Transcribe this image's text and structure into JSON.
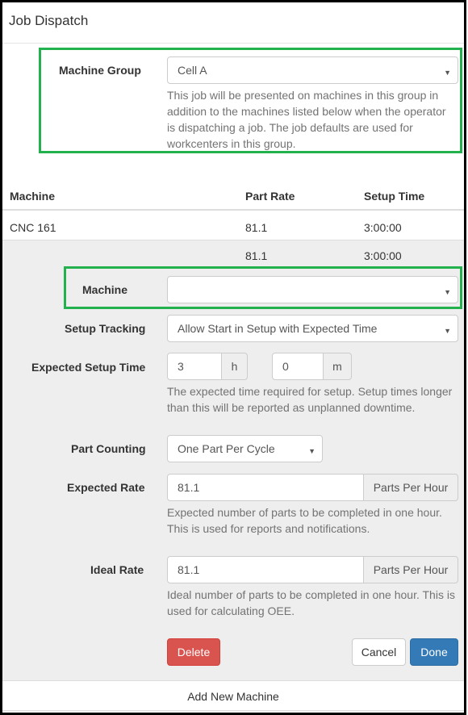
{
  "dialog": {
    "title": "Job Dispatch"
  },
  "machine_group": {
    "label": "Machine Group",
    "value": "Cell A",
    "help": "This job will be presented on machines in this group in addition to the machines listed below when the operator is dispatching a job. The job defaults are used for workcenters in this group."
  },
  "table": {
    "columns": [
      "Machine",
      "Part Rate",
      "Setup Time"
    ],
    "rows": [
      {
        "machine": "CNC 161",
        "part_rate": "81.1",
        "setup_time": "3:00:00"
      },
      {
        "machine": "",
        "part_rate": "81.1",
        "setup_time": "3:00:00"
      }
    ]
  },
  "edit": {
    "machine": {
      "label": "Machine",
      "value": ""
    },
    "setup_tracking": {
      "label": "Setup Tracking",
      "value": "Allow Start in Setup with Expected Time"
    },
    "expected_setup_time": {
      "label": "Expected Setup Time",
      "hours": "3",
      "hours_unit": "h",
      "minutes": "0",
      "minutes_unit": "m",
      "help": "The expected time required for setup. Setup times longer than this will be reported as unplanned downtime."
    },
    "part_counting": {
      "label": "Part Counting",
      "value": "One Part Per Cycle"
    },
    "expected_rate": {
      "label": "Expected Rate",
      "value": "81.1",
      "unit": "Parts Per Hour",
      "help": "Expected number of parts to be completed in one hour. This is used for reports and notifications."
    },
    "ideal_rate": {
      "label": "Ideal Rate",
      "value": "81.1",
      "unit": "Parts Per Hour",
      "help": "Ideal number of parts to be completed in one hour. This is used for calculating OEE."
    },
    "buttons": {
      "delete": "Delete",
      "cancel": "Cancel",
      "done": "Done"
    }
  },
  "add_new_machine": "Add New Machine",
  "colors": {
    "highlight": "#22b14c",
    "danger": "#d9534f",
    "primary": "#337ab7"
  }
}
